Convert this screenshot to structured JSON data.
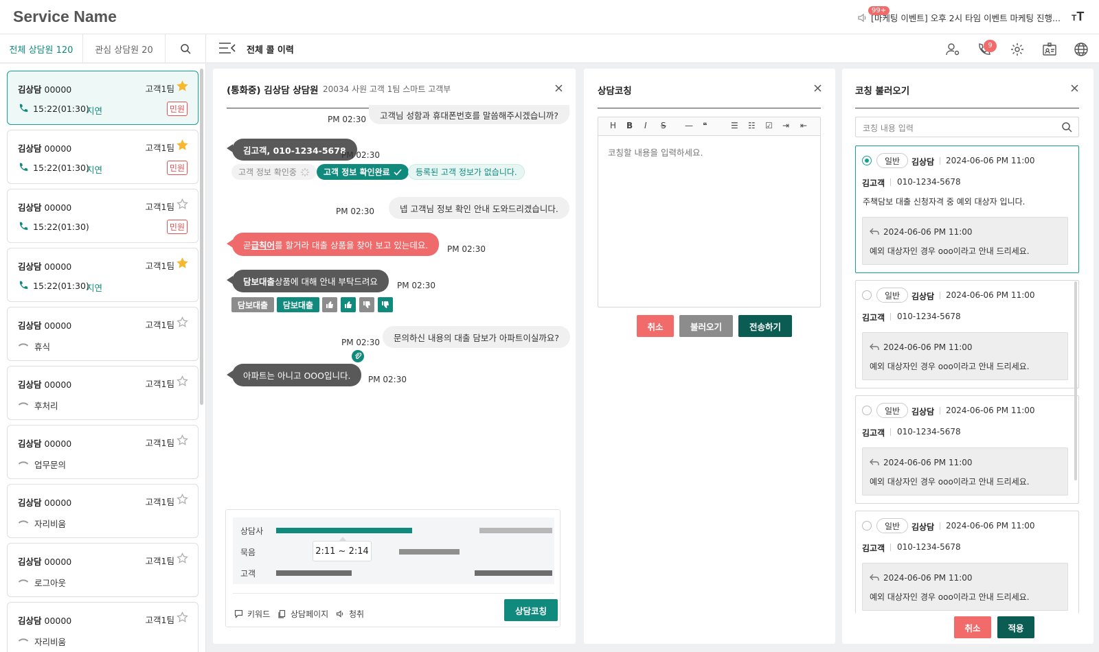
{
  "app": {
    "title": "Service Name"
  },
  "header": {
    "notice_badge": "99+",
    "notice_text": "[마케팅 이벤트] 오후 2시 타임 이벤트 마케팅 진행...",
    "text_size_icon": "text-size-icon"
  },
  "subbar": {
    "tab_all": "전체 상담원 120",
    "tab_watch": "관심 상담원 20",
    "section_title": "전체 콜 이력",
    "alarm_badge": "9",
    "icons": [
      "user-settings-icon",
      "call-alert-icon",
      "gear-icon",
      "id-card-icon",
      "globe-icon"
    ]
  },
  "agents": [
    {
      "name": "김상담",
      "id": "00000",
      "team": "고객1팀",
      "starred": true,
      "status_type": "call",
      "time": "15:22(01:30)",
      "delay": "지연",
      "complaint": "민원"
    },
    {
      "name": "김상담",
      "id": "00000",
      "team": "고객1팀",
      "starred": true,
      "status_type": "call",
      "time": "15:22(01:30)",
      "delay": "지연",
      "complaint": "민원"
    },
    {
      "name": "김상담",
      "id": "00000",
      "team": "고객1팀",
      "starred": false,
      "status_type": "call",
      "time": "15:22(01:30)",
      "delay": "",
      "complaint": "민원"
    },
    {
      "name": "김상담",
      "id": "00000",
      "team": "고객1팀",
      "starred": true,
      "status_type": "call",
      "time": "15:22(01:30)",
      "delay": "지연",
      "complaint": ""
    },
    {
      "name": "김상담",
      "id": "00000",
      "team": "고객1팀",
      "starred": false,
      "status_type": "idle",
      "time": "휴식",
      "delay": "",
      "complaint": ""
    },
    {
      "name": "김상담",
      "id": "00000",
      "team": "고객1팀",
      "starred": false,
      "status_type": "idle",
      "time": "후처리",
      "delay": "",
      "complaint": ""
    },
    {
      "name": "김상담",
      "id": "00000",
      "team": "고객1팀",
      "starred": false,
      "status_type": "idle",
      "time": "업무문의",
      "delay": "",
      "complaint": ""
    },
    {
      "name": "김상담",
      "id": "00000",
      "team": "고객1팀",
      "starred": false,
      "status_type": "idle",
      "time": "자리비움",
      "delay": "",
      "complaint": ""
    },
    {
      "name": "김상담",
      "id": "00000",
      "team": "고객1팀",
      "starred": false,
      "status_type": "idle",
      "time": "로그아웃",
      "delay": "",
      "complaint": ""
    },
    {
      "name": "김상담",
      "id": "00000",
      "team": "고객1팀",
      "starred": false,
      "status_type": "idle",
      "time": "자리비움",
      "delay": "",
      "complaint": ""
    }
  ],
  "chat": {
    "title": "(통화중) 김상담 상담원",
    "subtitle": "20034  사원  고객 1팀  스마트 고객부",
    "msg1": "고객님 성함과 휴대폰번호를 말씀해주시겠습니까?",
    "msg2": "김고객, 010-1234-5678",
    "chip1": "고객 정보 확인중",
    "chip2": "고객 정보 확인완료",
    "chip3": "등록된 고객 정보가 없습니다.",
    "msg3": "넵 고객님 정보 확인 안내 도와드리겠습니다.",
    "msg4_pre": "곧 ",
    "msg4_hl": "급칙어",
    "msg4_post": "를 할거라 대출 상품을 찾아 보고 있는데요.",
    "msg5_hl": "담보대출",
    "msg5_post": " 상품에 대해 안내 부탁드려요",
    "tag1": "담보대출",
    "tag2": "담보대출",
    "msg6": "문의하신 내용의 대출 담보가 아파트이실까요?",
    "msg7": "아파트는 아니고 OOO입니다.",
    "time": "PM 02:30"
  },
  "analysis": {
    "label_agent": "상담사",
    "label_silence": "묵음",
    "label_customer": "고객",
    "tooltip": "2:11 ~ 2:14",
    "keyword": "키워드",
    "page": "상담페이지",
    "listen": "청취",
    "coach_button": "상담코칭"
  },
  "coaching": {
    "title": "상담코칭",
    "toolbar": [
      "H",
      "B",
      "I",
      "S",
      "—",
      "❝",
      "☰",
      "☷",
      "☑",
      "⇥",
      "⇤"
    ],
    "placeholder": "코칭할 내용을 입력하세요.",
    "cancel": "취소",
    "load": "불러오기",
    "send": "전송하기"
  },
  "load_panel": {
    "title": "코칭 불러오기",
    "search_placeholder": "코칭 내용 입력",
    "cards": [
      {
        "selected": true,
        "type": "일반",
        "author": "김상담",
        "date": "2024-06-06 PM 11:00",
        "customer": "김고객",
        "phone": "010-1234-5678",
        "text": "주책담보 대출 신청자격 중 예외 대상자 입니다.",
        "reply_date": "2024-06-06 PM 11:00",
        "reply_text": "예외 대상자인 경우 ooo이라고 안내 드리세요."
      },
      {
        "selected": false,
        "type": "일반",
        "author": "김상담",
        "date": "2024-06-06 PM 11:00",
        "customer": "김고객",
        "phone": "010-1234-5678",
        "text": "",
        "reply_date": "2024-06-06 PM 11:00",
        "reply_text": "예외 대상자인 경우 ooo이라고 안내 드리세요."
      },
      {
        "selected": false,
        "type": "일반",
        "author": "김상담",
        "date": "2024-06-06 PM 11:00",
        "customer": "김고객",
        "phone": "010-1234-5678",
        "text": "",
        "reply_date": "2024-06-06 PM 11:00",
        "reply_text": "예외 대상자인 경우 ooo이라고 안내 드리세요."
      },
      {
        "selected": false,
        "type": "일반",
        "author": "김상담",
        "date": "2024-06-06 PM 11:00",
        "customer": "김고객",
        "phone": "010-1234-5678",
        "text": "",
        "reply_date": "2024-06-06 PM 11:00",
        "reply_text": "예외 대상자인 경우 ooo이라고 안내 드리세요."
      }
    ],
    "cancel": "취소",
    "apply": "적용"
  },
  "colors": {
    "accent": "#0f8a7d",
    "accent_dark": "#0b5d54",
    "danger": "#f26b6b",
    "star": "#f5b82e"
  }
}
